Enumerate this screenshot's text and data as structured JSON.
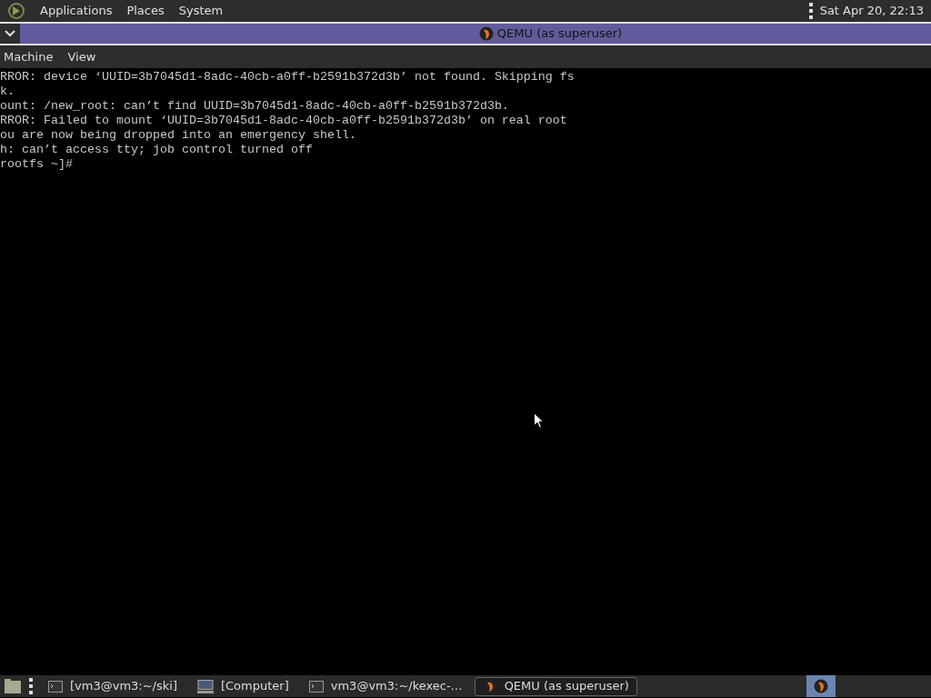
{
  "top_panel": {
    "menus": [
      "Applications",
      "Places",
      "System"
    ],
    "clock": "Sat Apr 20, 22:13"
  },
  "window": {
    "title": "QEMU (as superuser)",
    "menu": [
      "Machine",
      "View"
    ]
  },
  "console": {
    "lines": [
      "RROR: device ‘UUID=3b7045d1-8adc-40cb-a0ff-b2591b372d3b’ not found. Skipping fs",
      "k.",
      "ount: /new_root: can’t find UUID=3b7045d1-8adc-40cb-a0ff-b2591b372d3b.",
      "RROR: Failed to mount ‘UUID=3b7045d1-8adc-40cb-a0ff-b2591b372d3b’ on real root",
      "ou are now being dropped into an emergency shell.",
      "h: can’t access tty; job control turned off",
      "rootfs ~]#"
    ]
  },
  "taskbar": {
    "tasks": [
      {
        "kind": "terminal",
        "label": "[vm3@vm3:~/ski]",
        "selected": false
      },
      {
        "kind": "computer",
        "label": "[Computer]",
        "selected": false
      },
      {
        "kind": "terminal",
        "label": "vm3@vm3:~/kexec-…",
        "selected": false
      },
      {
        "kind": "qemu",
        "label": "QEMU (as superuser)",
        "selected": true
      }
    ]
  }
}
